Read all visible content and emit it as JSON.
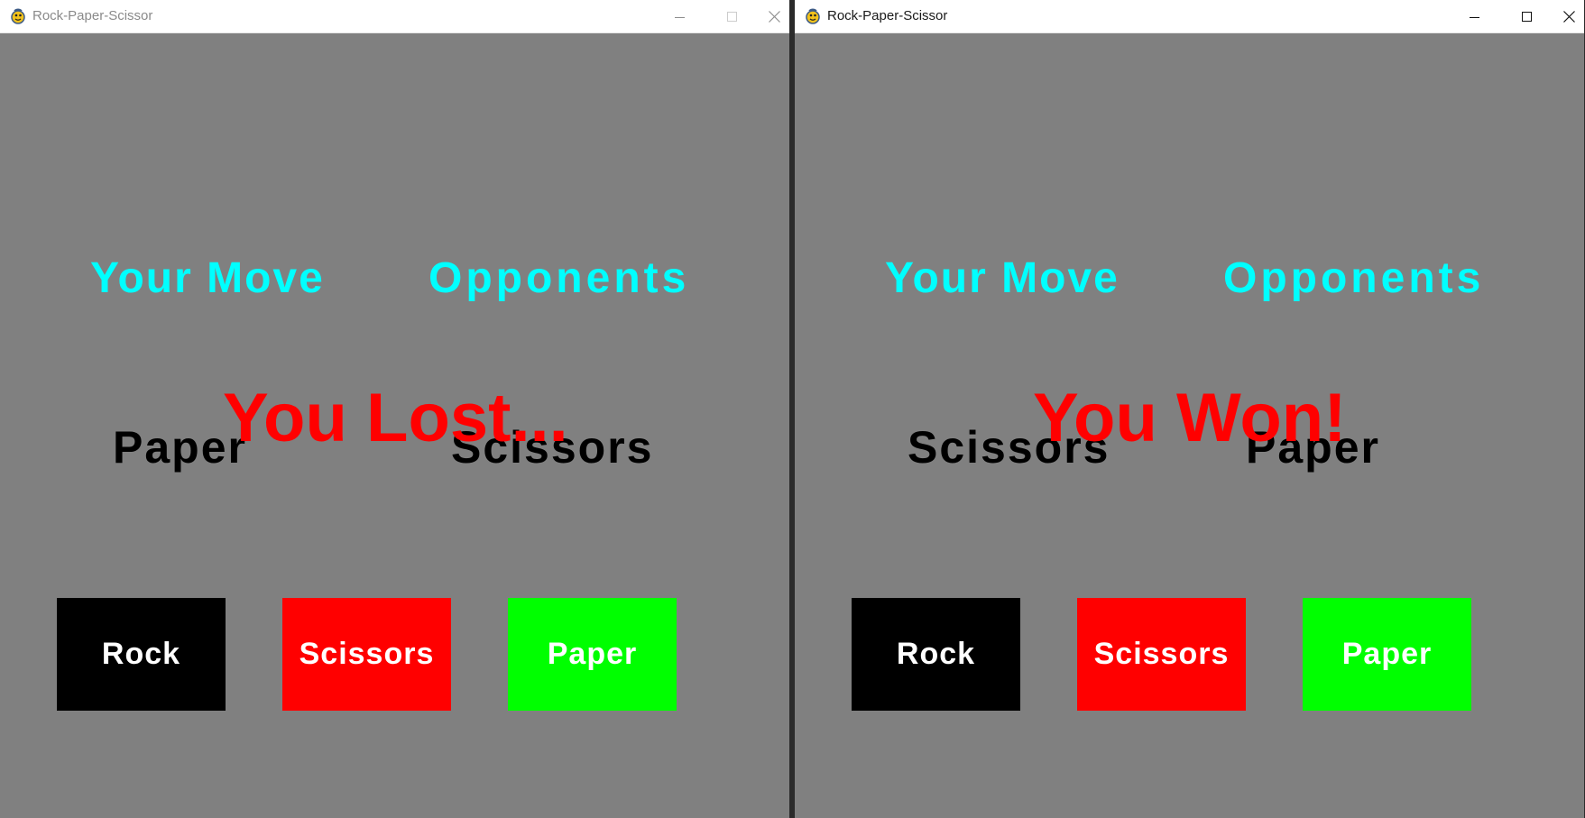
{
  "windows": [
    {
      "state": "inactive",
      "title": "Rock-Paper-Scissor",
      "headings": {
        "your_move": "Your Move",
        "opponents": "Opponents"
      },
      "your_choice": "Paper",
      "opponent_choice": "Scissors",
      "result": "You Lost...",
      "buttons": {
        "rock": "Rock",
        "scissors": "Scissors",
        "paper": "Paper"
      }
    },
    {
      "state": "active",
      "title": "Rock-Paper-Scissor",
      "headings": {
        "your_move": "Your Move",
        "opponents": "Opponents"
      },
      "your_choice": "Scissors",
      "opponent_choice": "Paper",
      "result": "You Won!",
      "buttons": {
        "rock": "Rock",
        "scissors": "Scissors",
        "paper": "Paper"
      }
    }
  ],
  "colors": {
    "background": "#808080",
    "heading": "#00ffff",
    "result": "#ff0000",
    "move_text": "#000000",
    "rock_button": "#000000",
    "scissors_button": "#ff0000",
    "paper_button": "#00ff00"
  },
  "icons": {
    "app": "pygame-snake-icon",
    "minimize": "minimize-icon",
    "maximize": "maximize-icon",
    "close": "close-icon"
  }
}
